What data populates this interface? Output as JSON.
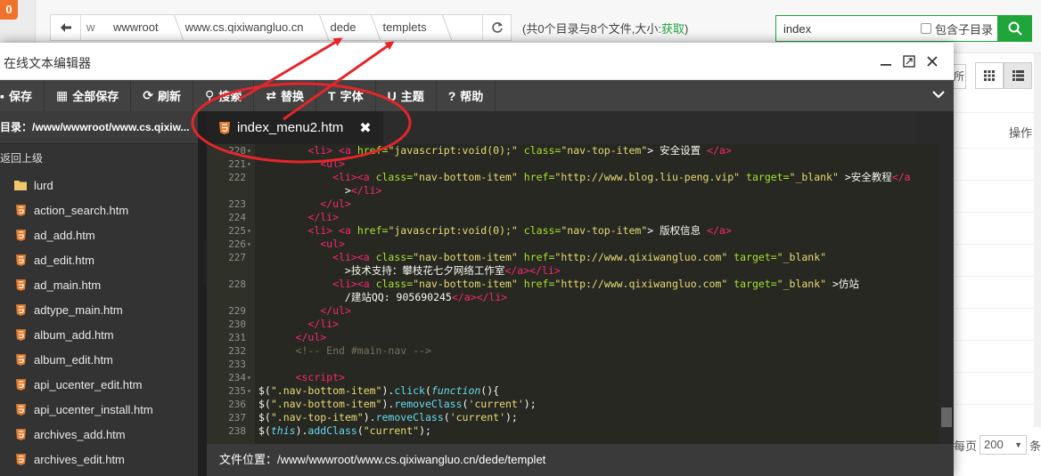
{
  "badge": "0",
  "breadcrumb": [
    "w",
    "wwwroot",
    "www.cs.qixiwangluo.cn",
    "dede",
    "templets"
  ],
  "summary": {
    "text": "(共0个目录与8个文件,大小:",
    "link": "获取",
    "close": ")"
  },
  "search": {
    "value": "index",
    "include_subdir": "包含子目录"
  },
  "bg": {
    "op_header": "操作",
    "per_page_label": "每页",
    "per_page": "200",
    "per_page_suffix": "条"
  },
  "modal": {
    "title": "在线文本编辑器",
    "controls": {
      "minimize": "—",
      "maximize": "⤢",
      "close": "✕"
    },
    "toolbar": [
      {
        "label": "保存",
        "icon": "save-icon",
        "glyph": "💾"
      },
      {
        "label": "全部保存",
        "icon": "save-all-icon",
        "glyph": "▦"
      },
      {
        "label": "刷新",
        "icon": "refresh-icon",
        "glyph": "⟳"
      },
      {
        "label": "搜索",
        "icon": "search-icon",
        "glyph": "⚲"
      },
      {
        "label": "替换",
        "icon": "replace-icon",
        "glyph": "⇄"
      },
      {
        "label": "字体",
        "icon": "font-icon",
        "glyph": "T"
      },
      {
        "label": "主题",
        "icon": "theme-icon",
        "glyph": "U"
      },
      {
        "label": "帮助",
        "icon": "help-icon",
        "glyph": "?"
      }
    ],
    "sidebar": {
      "path": "目录：/www/wwwroot/www.cs.qixiw...",
      "up": "返回上级",
      "items": [
        {
          "name": "lurd",
          "type": "folder"
        },
        {
          "name": "action_search.htm",
          "type": "html"
        },
        {
          "name": "ad_add.htm",
          "type": "html"
        },
        {
          "name": "ad_edit.htm",
          "type": "html"
        },
        {
          "name": "ad_main.htm",
          "type": "html"
        },
        {
          "name": "adtype_main.htm",
          "type": "html"
        },
        {
          "name": "album_add.htm",
          "type": "html"
        },
        {
          "name": "album_edit.htm",
          "type": "html"
        },
        {
          "name": "api_ucenter_edit.htm",
          "type": "html"
        },
        {
          "name": "api_ucenter_install.htm",
          "type": "html"
        },
        {
          "name": "archives_add.htm",
          "type": "html"
        },
        {
          "name": "archives_edit.htm",
          "type": "html"
        }
      ]
    },
    "tab": {
      "label": "index_menu2.htm",
      "close": "✖"
    },
    "code_lines": [
      {
        "n": "220",
        "fold": true,
        "segs": [
          [
            "p",
            "        "
          ],
          [
            "tag",
            "<li>"
          ],
          [
            "p",
            " "
          ],
          [
            "tag",
            "<a"
          ],
          [
            "p",
            " "
          ],
          [
            "attr",
            "href="
          ],
          [
            "str",
            "\"javascript:void(0);\""
          ],
          [
            "p",
            " "
          ],
          [
            "attr",
            "class="
          ],
          [
            "str",
            "\"nav-top-item\""
          ],
          [
            "p",
            "> 安全设置 "
          ],
          [
            "tag",
            "</a>"
          ]
        ]
      },
      {
        "n": "221",
        "fold": true,
        "segs": [
          [
            "p",
            "          "
          ],
          [
            "tag",
            "<ul>"
          ]
        ]
      },
      {
        "n": "222",
        "fold": false,
        "segs": [
          [
            "p",
            "            "
          ],
          [
            "tag",
            "<li><a"
          ],
          [
            "p",
            " "
          ],
          [
            "attr",
            "class="
          ],
          [
            "str",
            "\"nav-bottom-item\""
          ],
          [
            "p",
            " "
          ],
          [
            "attr",
            "href="
          ],
          [
            "str",
            "\"http://www.blog.liu-peng.vip\""
          ],
          [
            "p",
            " "
          ],
          [
            "attr",
            "target="
          ],
          [
            "str",
            "\"_blank\""
          ],
          [
            "p",
            " >安全教程"
          ],
          [
            "tag",
            "</a"
          ]
        ]
      },
      {
        "n": "",
        "fold": false,
        "segs": [
          [
            "p",
            "              >"
          ],
          [
            "tag",
            "</li>"
          ]
        ]
      },
      {
        "n": "223",
        "fold": false,
        "segs": [
          [
            "p",
            "          "
          ],
          [
            "tag",
            "</ul>"
          ]
        ]
      },
      {
        "n": "224",
        "fold": false,
        "segs": [
          [
            "p",
            "        "
          ],
          [
            "tag",
            "</li>"
          ]
        ]
      },
      {
        "n": "225",
        "fold": true,
        "segs": [
          [
            "p",
            "        "
          ],
          [
            "tag",
            "<li>"
          ],
          [
            "p",
            " "
          ],
          [
            "tag",
            "<a"
          ],
          [
            "p",
            " "
          ],
          [
            "attr",
            "href="
          ],
          [
            "str",
            "\"javascript:void(0);\""
          ],
          [
            "p",
            " "
          ],
          [
            "attr",
            "class="
          ],
          [
            "str",
            "\"nav-top-item\""
          ],
          [
            "p",
            "> 版权信息 "
          ],
          [
            "tag",
            "</a>"
          ]
        ]
      },
      {
        "n": "226",
        "fold": true,
        "segs": [
          [
            "p",
            "          "
          ],
          [
            "tag",
            "<ul>"
          ]
        ]
      },
      {
        "n": "227",
        "fold": false,
        "segs": [
          [
            "p",
            "            "
          ],
          [
            "tag",
            "<li><a"
          ],
          [
            "p",
            " "
          ],
          [
            "attr",
            "class="
          ],
          [
            "str",
            "\"nav-bottom-item\""
          ],
          [
            "p",
            " "
          ],
          [
            "attr",
            "href="
          ],
          [
            "str",
            "\"http://www.qixiwangluo.com\""
          ],
          [
            "p",
            " "
          ],
          [
            "attr",
            "target="
          ],
          [
            "str",
            "\"_blank\""
          ]
        ]
      },
      {
        "n": "",
        "fold": false,
        "segs": [
          [
            "p",
            "              >技术支持：攀枝花七夕网络工作室"
          ],
          [
            "tag",
            "</a></li>"
          ]
        ]
      },
      {
        "n": "228",
        "fold": false,
        "segs": [
          [
            "p",
            "            "
          ],
          [
            "tag",
            "<li><a"
          ],
          [
            "p",
            " "
          ],
          [
            "attr",
            "class="
          ],
          [
            "str",
            "\"nav-bottom-item\""
          ],
          [
            "p",
            " "
          ],
          [
            "attr",
            "href="
          ],
          [
            "str",
            "\"http://www.qixiwangluo.com\""
          ],
          [
            "p",
            " "
          ],
          [
            "attr",
            "target="
          ],
          [
            "str",
            "\"_blank\""
          ],
          [
            "p",
            " >仿站"
          ]
        ]
      },
      {
        "n": "",
        "fold": false,
        "segs": [
          [
            "p",
            "              /建站QQ: 905690245"
          ],
          [
            "tag",
            "</a></li>"
          ]
        ]
      },
      {
        "n": "229",
        "fold": false,
        "segs": [
          [
            "p",
            "          "
          ],
          [
            "tag",
            "</ul>"
          ]
        ]
      },
      {
        "n": "230",
        "fold": false,
        "segs": [
          [
            "p",
            "        "
          ],
          [
            "tag",
            "</li>"
          ]
        ]
      },
      {
        "n": "231",
        "fold": false,
        "segs": [
          [
            "p",
            "      "
          ],
          [
            "tag",
            "</ul>"
          ]
        ]
      },
      {
        "n": "232",
        "fold": false,
        "segs": [
          [
            "p",
            "      "
          ],
          [
            "cm",
            "<!-- End #main-nav -->"
          ]
        ]
      },
      {
        "n": "233",
        "fold": false,
        "segs": [
          [
            "p",
            ""
          ]
        ]
      },
      {
        "n": "234",
        "fold": true,
        "segs": [
          [
            "p",
            "      "
          ],
          [
            "tag",
            "<script>"
          ]
        ]
      },
      {
        "n": "235",
        "fold": true,
        "segs": [
          [
            "p",
            "$("
          ],
          [
            "str",
            "\".nav-bottom-item\""
          ],
          [
            "p",
            ")."
          ],
          [
            "fn",
            "click"
          ],
          [
            "p",
            "("
          ],
          [
            "kw",
            "function"
          ],
          [
            "p",
            "(){"
          ]
        ]
      },
      {
        "n": "236",
        "fold": false,
        "segs": [
          [
            "p",
            "$("
          ],
          [
            "str",
            "\".nav-bottom-item\""
          ],
          [
            "p",
            ")."
          ],
          [
            "fn",
            "removeClass"
          ],
          [
            "p",
            "("
          ],
          [
            "str",
            "'current'"
          ],
          [
            "p",
            ");"
          ]
        ]
      },
      {
        "n": "237",
        "fold": false,
        "segs": [
          [
            "p",
            "$("
          ],
          [
            "str",
            "\".nav-top-item\""
          ],
          [
            "p",
            ")."
          ],
          [
            "fn",
            "removeClass"
          ],
          [
            "p",
            "("
          ],
          [
            "str",
            "'current'"
          ],
          [
            "p",
            ");"
          ]
        ]
      },
      {
        "n": "238",
        "fold": false,
        "segs": [
          [
            "p",
            "$("
          ],
          [
            "kw",
            "this"
          ],
          [
            "p",
            ")."
          ],
          [
            "fn",
            "addClass"
          ],
          [
            "p",
            "("
          ],
          [
            "str",
            "\"current\""
          ],
          [
            "p",
            ");"
          ]
        ]
      }
    ],
    "status": "文件位置：/www/wwwroot/www.cs.qixiwangluo.cn/dede/templet"
  },
  "colors": {
    "accent": "#20a53a",
    "annotation": "#e5252a",
    "html_icon": "#e07b2c",
    "folder_icon": "#f2c66b"
  }
}
